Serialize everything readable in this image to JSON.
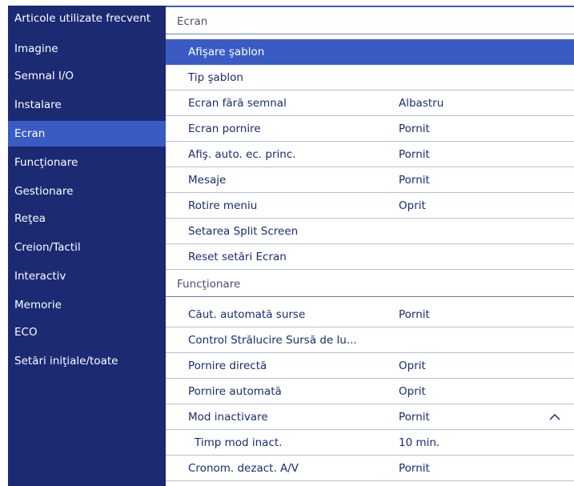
{
  "sidebar": {
    "items": [
      {
        "label": "Articole utilizate frecvent"
      },
      {
        "label": "Imagine"
      },
      {
        "label": "Semnal I/O"
      },
      {
        "label": "Instalare"
      },
      {
        "label": "Ecran"
      },
      {
        "label": "Funcţionare"
      },
      {
        "label": "Gestionare"
      },
      {
        "label": "Reţea"
      },
      {
        "label": "Creion/Tactil"
      },
      {
        "label": "Interactiv"
      },
      {
        "label": "Memorie"
      },
      {
        "label": "ECO"
      },
      {
        "label": "Setări iniţiale/toate"
      }
    ],
    "active_index": 4
  },
  "main": {
    "sections": [
      {
        "header": "Ecran",
        "rows": [
          {
            "label": "Afişare şablon",
            "value": ""
          },
          {
            "label": "Tip şablon",
            "value": ""
          },
          {
            "label": "Ecran fără semnal",
            "value": "Albastru"
          },
          {
            "label": "Ecran pornire",
            "value": "Pornit"
          },
          {
            "label": "Afiş. auto. ec. princ.",
            "value": "Pornit"
          },
          {
            "label": "Mesaje",
            "value": "Pornit"
          },
          {
            "label": "Rotire meniu",
            "value": "Oprit"
          },
          {
            "label": "Setarea Split Screen",
            "value": ""
          },
          {
            "label": "Reset setări Ecran",
            "value": ""
          }
        ]
      },
      {
        "header": "Funcţionare",
        "rows": [
          {
            "label": "Căut. automată surse",
            "value": "Pornit"
          },
          {
            "label": "Control Strălucire Sursă de lu...",
            "value": ""
          },
          {
            "label": "Pornire directă",
            "value": "Oprit"
          },
          {
            "label": "Pornire automată",
            "value": "Oprit"
          },
          {
            "label": "Mod inactivare",
            "value": "Pornit"
          },
          {
            "label": "Timp mod inact.",
            "value": "10 min."
          },
          {
            "label": "Cronom. dezact. A/V",
            "value": "Pornit"
          }
        ]
      }
    ],
    "selected_row": "Afişare şablon",
    "expanded_icon": "chevron-up-icon"
  },
  "colors": {
    "sidebar_bg": "#1b2a73",
    "accent": "#3a5bc4",
    "text": "#1b2a73"
  }
}
